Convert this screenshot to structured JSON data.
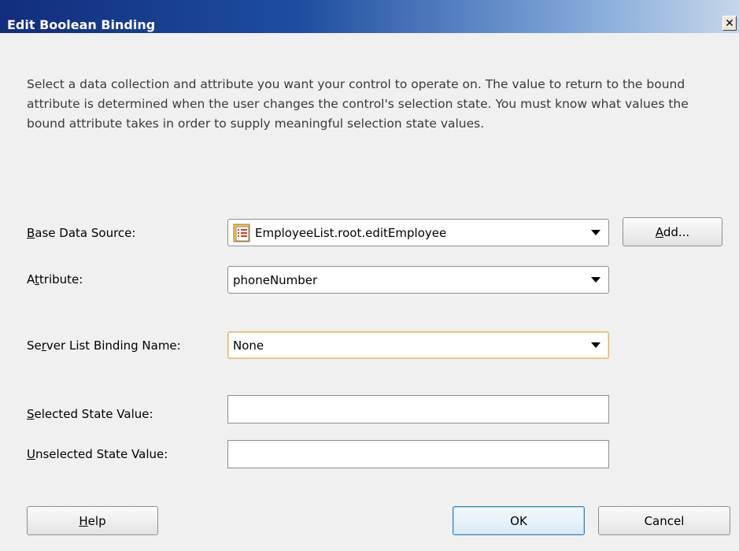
{
  "window": {
    "title": "Edit Boolean Binding",
    "close_glyph": "✕"
  },
  "description": "Select a data collection and attribute you want your control to operate on. The value to return to the bound attribute is determined when the user changes the control's selection state. You must know what values the bound attribute takes in order to supply meaningful selection state values.",
  "form": {
    "base_data_source": {
      "label_mnemonic": "B",
      "label_rest": "ase Data Source:",
      "value": "EmployeeList.root.editEmployee",
      "icon": "data-collection-icon"
    },
    "add_button": {
      "mnemonic": "A",
      "rest": "dd..."
    },
    "attribute": {
      "label_pre": "A",
      "label_mnemonic": "t",
      "label_rest": "tribute:",
      "value": "phoneNumber"
    },
    "server_list_binding": {
      "label_pre": "Se",
      "label_mnemonic": "r",
      "label_rest": "ver List Binding Name:",
      "value": "None"
    },
    "selected_state": {
      "label_mnemonic": "S",
      "label_rest": "elected State Value:",
      "value": ""
    },
    "unselected_state": {
      "label_mnemonic": "U",
      "label_rest": "nselected State Value:",
      "value": ""
    }
  },
  "buttons": {
    "help": {
      "mnemonic": "H",
      "rest": "elp"
    },
    "ok": "OK",
    "cancel": "Cancel"
  },
  "colors": {
    "titlebar_start": "#122d7e",
    "titlebar_end": "#c6d6ea",
    "focus_border": "#e3b46a",
    "default_button_border": "#3c7fb1"
  }
}
